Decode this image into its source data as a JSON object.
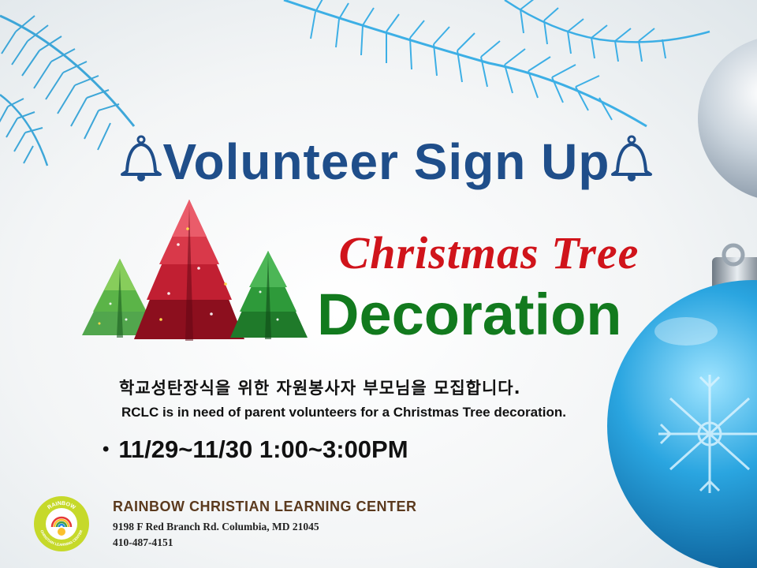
{
  "flyer": {
    "title": "Volunteer Sign Up",
    "subtitle_script": "Christmas Tree",
    "subtitle_main": "Decoration",
    "korean_text": "학교성탄장식을 위한 자원봉사자 부모님을 모집합니다.",
    "english_text": "RCLC is in need of parent volunteers for a Christmas Tree decoration.",
    "bullet": "•",
    "dates": "11/29~11/30  1:00~3:00PM"
  },
  "organization": {
    "name": "RAINBOW CHRISTIAN LEARNING CENTER",
    "address": "9198 F Red Branch Rd. Columbia, MD 21045",
    "phone": "410-487-4151",
    "logo_text_top": "RAINBOW",
    "logo_text_bottom": "CHRISTIAN LEARNING CENTER"
  },
  "icons": {
    "title_left": "bell-icon",
    "title_right": "bell-icon",
    "trees": "christmas-trees-icon",
    "ornaments": "ornament-ball-icon",
    "logo": "rainbow-logo-icon"
  },
  "colors": {
    "title": "#1f4e8a",
    "script": "#d0141b",
    "decoration": "#127a1e",
    "org_name": "#5b3a1e",
    "logo": "#c6d92a"
  }
}
